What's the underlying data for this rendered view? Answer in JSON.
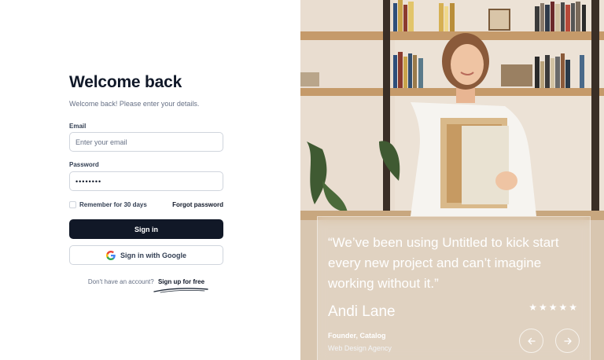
{
  "login": {
    "title": "Welcome back",
    "subtitle": "Welcome back! Please enter your details.",
    "email_label": "Email",
    "email_placeholder": "Enter your email",
    "password_label": "Password",
    "password_value": "••••••••",
    "remember_label": "Remember for 30 days",
    "forgot_label": "Forgot password",
    "signin_label": "Sign in",
    "google_label": "Sign in with Google",
    "no_account_text": "Don't have an account?",
    "signup_label": "Sign up for free"
  },
  "testimonial": {
    "quote": "“We’ve been using Untitled to kick start every new project and can’t imagine working without it.”",
    "name": "Andi Lane",
    "role": "Founder, Catalog",
    "company": "Web Design Agency",
    "stars": "★★★★★",
    "rating": 5
  },
  "colors": {
    "primary_button": "#111827",
    "border": "#d0d5dd",
    "text_primary": "#101828",
    "text_secondary": "#667085"
  },
  "icons": {
    "google": "google-icon",
    "prev": "arrow-left-icon",
    "next": "arrow-right-icon"
  }
}
